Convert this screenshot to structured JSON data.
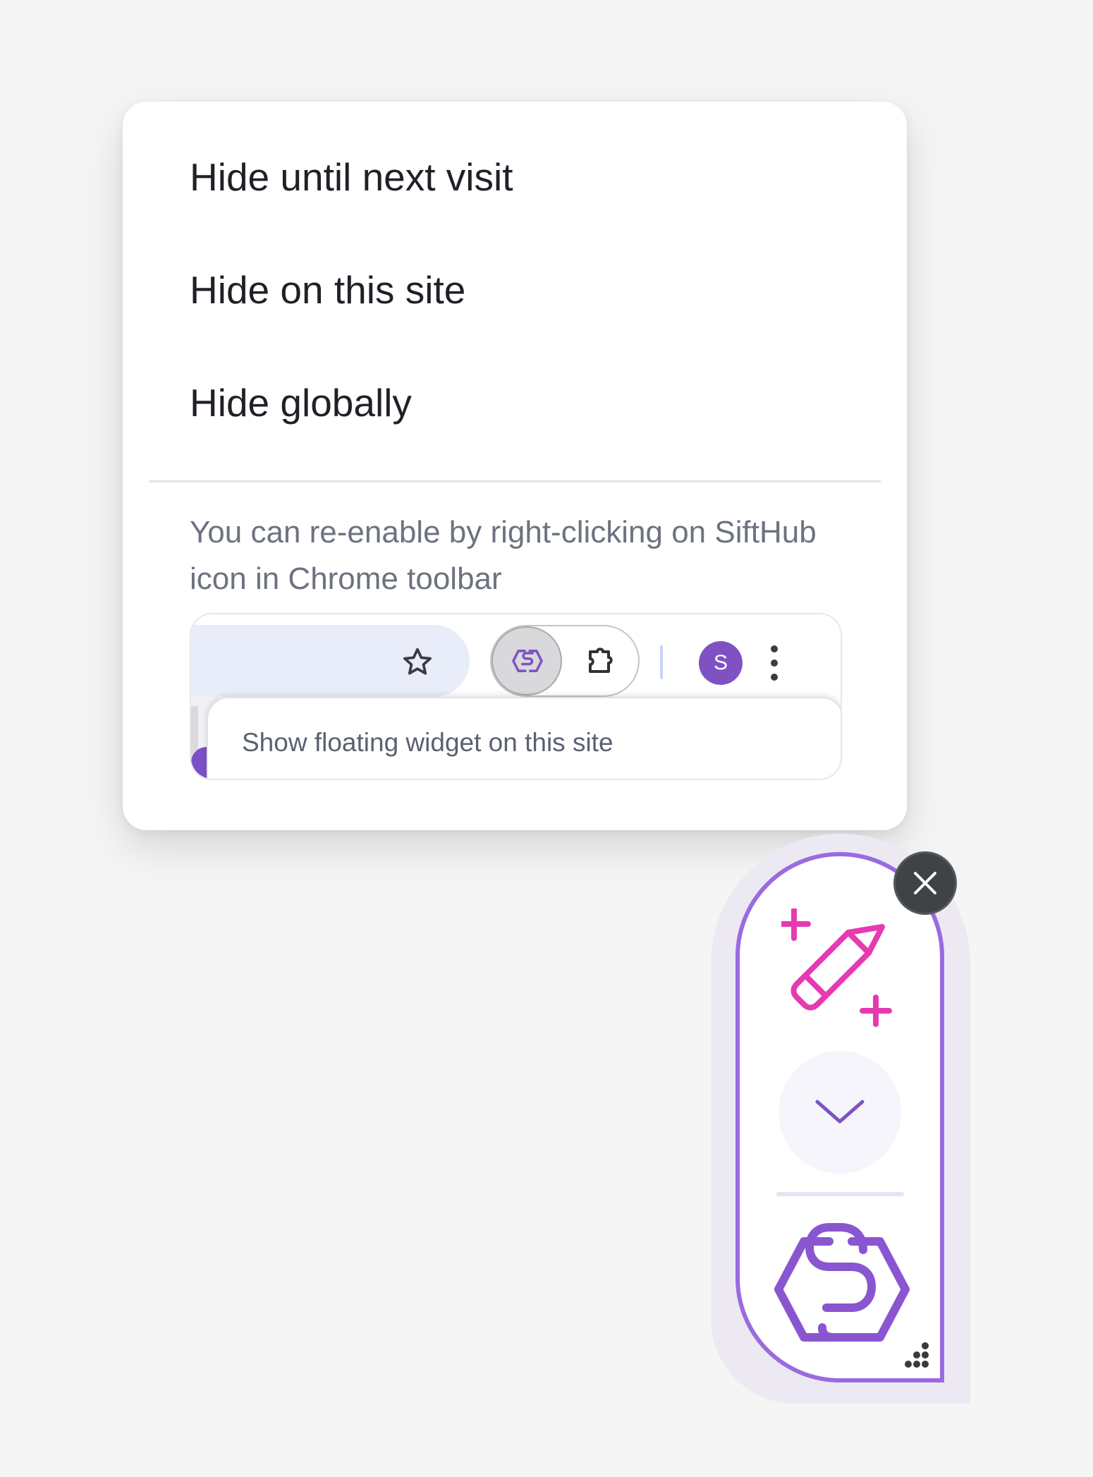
{
  "menu": {
    "items": [
      {
        "label": "Hide until next visit"
      },
      {
        "label": "Hide on this site"
      },
      {
        "label": "Hide globally"
      }
    ],
    "hint": "You can re-enable by right-clicking on SiftHub icon in Chrome toolbar"
  },
  "toolbar_illustration": {
    "avatar_letter": "S",
    "context_menu_item": "Show floating widget on this site",
    "icons": [
      "star-icon",
      "sifthub-icon",
      "puzzle-icon",
      "more-vert-icon"
    ]
  },
  "widget": {
    "icons": [
      "close-icon",
      "magic-pencil-icon",
      "chevron-down-icon",
      "sifthub-logo-icon",
      "drag-handle-icon"
    ]
  },
  "colors": {
    "brand_purple": "#7e52c2",
    "widget_border": "#9a6be0",
    "pencil_pink": "#e63ab0",
    "close_bg": "#3f4346",
    "hint_text": "#6d7280"
  }
}
